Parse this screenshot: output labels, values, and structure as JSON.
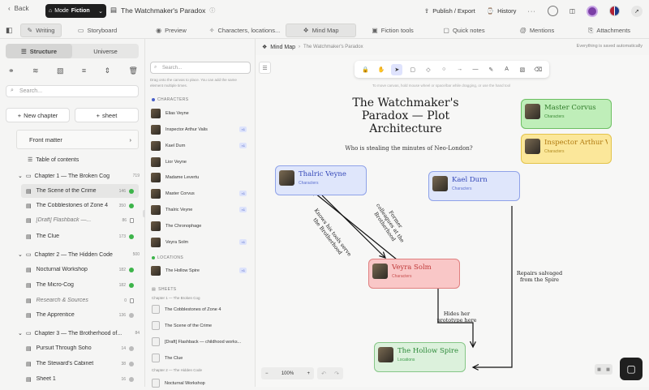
{
  "topbar": {
    "back_label": "Back",
    "mode_label": "Mode",
    "mode_value": "Fiction",
    "doc_title": "The Watchmaker's Paradox",
    "publish_label": "Publish / Export",
    "history_label": "History"
  },
  "tabs": [
    {
      "label": "Writing",
      "icon": "pen-icon"
    },
    {
      "label": "Storyboard",
      "icon": "board-icon"
    },
    {
      "label": "Preview",
      "icon": "eye-icon"
    },
    {
      "label": "Characters, locations...",
      "icon": "wand-icon"
    },
    {
      "label": "Mind Map",
      "icon": "map-icon"
    },
    {
      "label": "Fiction tools",
      "icon": "tools-icon"
    },
    {
      "label": "Quick notes",
      "icon": "note-icon"
    },
    {
      "label": "Mentions",
      "icon": "at-icon"
    },
    {
      "label": "Attachments",
      "icon": "clip-icon"
    }
  ],
  "left": {
    "structure_label": "Structure",
    "universe_label": "Universe",
    "search_placeholder": "Search...",
    "new_chapter_label": "New chapter",
    "sheet_label": "sheet",
    "front_matter": "Front matter",
    "toc": "Table of contents",
    "chapters": [
      {
        "title": "Chapter 1 — The Broken Cog",
        "count": "719",
        "items": [
          {
            "name": "The Scene of the Crime",
            "count": "146",
            "status": "green"
          },
          {
            "name": "The Cobblestones of Zone 4",
            "count": "350",
            "status": "green"
          },
          {
            "name": "[Draft] Flashback —...",
            "count": "86",
            "status": "doc"
          },
          {
            "name": "The Clue",
            "count": "173",
            "status": "green"
          }
        ]
      },
      {
        "title": "Chapter 2 — The Hidden Code",
        "count": "500",
        "items": [
          {
            "name": "Nocturnal Workshop",
            "count": "182",
            "status": "green"
          },
          {
            "name": "The Micro-Cog",
            "count": "182",
            "status": "green"
          },
          {
            "name": "Research & Sources",
            "count": "0",
            "status": "doc"
          },
          {
            "name": "The Apprentice",
            "count": "136",
            "status": "grey"
          }
        ]
      },
      {
        "title": "Chapter 3 — The Brotherhood of...",
        "count": "84",
        "items": [
          {
            "name": "Pursuit Through Soho",
            "count": "14",
            "status": "grey"
          },
          {
            "name": "The Steward's Cabinet",
            "count": "38",
            "status": "grey"
          },
          {
            "name": "Sheet 1",
            "count": "16",
            "status": "grey"
          }
        ]
      }
    ]
  },
  "middle": {
    "search_placeholder": "Search...",
    "hint": "Drag onto the canvas to place. You can add the same element multiple times.",
    "characters_heading": "CHARACTERS",
    "characters": [
      {
        "name": "Elias Veyne",
        "badge": ""
      },
      {
        "name": "Inspector Arthur Valis",
        "badge": "×1"
      },
      {
        "name": "Kael Durn",
        "badge": "×1"
      },
      {
        "name": "Lior Veyne",
        "badge": ""
      },
      {
        "name": "Madame Levertu",
        "badge": ""
      },
      {
        "name": "Master Corvus",
        "badge": "×1"
      },
      {
        "name": "Thalric Veyne",
        "badge": "×1"
      },
      {
        "name": "The Chronophage",
        "badge": ""
      },
      {
        "name": "Veyra Solm",
        "badge": "×1"
      }
    ],
    "locations_heading": "LOCATIONS",
    "locations": [
      {
        "name": "The Hollow Spire",
        "badge": "×1"
      }
    ],
    "sheets_heading": "SHEETS",
    "sheet_groups": [
      {
        "chapter": "Chapter 1 — The Broken Cog",
        "sheets": [
          "The Cobblestones of Zone 4",
          "The Scene of the Crime",
          "[Draft] Flashback — childhood works...",
          "The Clue"
        ]
      },
      {
        "chapter": "Chapter 2 — The Hidden Code",
        "sheets": [
          "Nocturnal Workshop"
        ]
      }
    ]
  },
  "canvas": {
    "breadcrumb_main": "Mind Map",
    "breadcrumb_sub": "The Watchmaker's Paradox",
    "saved_text": "Everything is saved automatically",
    "hint": "To move canvas, hold mouse wheel or space/bar while dragging, or use the hand tool",
    "title": "The Watchmaker's Paradox — Plot Architecture",
    "question": "Who is stealing the minutes of Neo-London?",
    "zoom": "100%",
    "nodes": {
      "thalric": {
        "name": "Thalric Veyne",
        "type": "Characters"
      },
      "kael": {
        "name": "Kael Durn",
        "type": "Characters"
      },
      "veyra": {
        "name": "Veyra Solm",
        "type": "Characters"
      },
      "spire": {
        "name": "The Hollow Spire",
        "type": "Locations"
      },
      "corvus": {
        "name": "Master Corvus",
        "type": "Characters"
      },
      "arthur": {
        "name": "Inspector Arthur V",
        "type": "Characters"
      }
    },
    "edges": {
      "former": "Former colleagues at the Brotherhood",
      "knows": "Knows his tools serve the Brotherhood",
      "repairs": "Repairs salvaged from the Spire",
      "hides": "Hides her prototype here"
    }
  },
  "colors": {
    "character_node": "#dfe6fb",
    "veyra_node": "#f9c7c7",
    "location_node": "#dcf1dc",
    "corvus_node": "#bfeeb9",
    "arthur_node": "#fbe79a"
  }
}
